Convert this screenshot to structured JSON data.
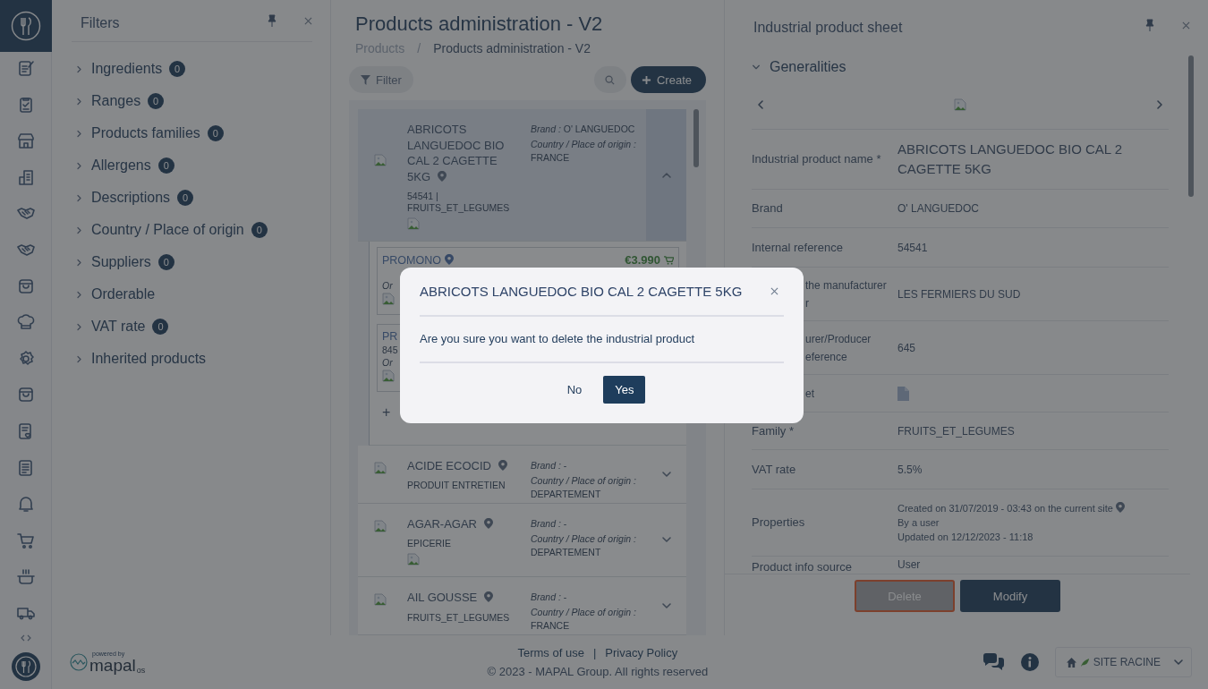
{
  "filters": {
    "title": "Filters",
    "items": [
      {
        "label": "Ingredients",
        "count": "0"
      },
      {
        "label": "Ranges",
        "count": "0"
      },
      {
        "label": "Products families",
        "count": "0"
      },
      {
        "label": "Allergens",
        "count": "0"
      },
      {
        "label": "Descriptions",
        "count": "0"
      },
      {
        "label": "Country / Place of origin",
        "count": "0"
      },
      {
        "label": "Suppliers",
        "count": "0"
      },
      {
        "label": "Orderable"
      },
      {
        "label": "VAT rate",
        "count": "0"
      },
      {
        "label": "Inherited products"
      }
    ]
  },
  "products": {
    "title": "Products administration - V2",
    "breadcrumb": [
      "Products",
      "Products administration - V2"
    ],
    "breadcrumb_separator": "/",
    "filter_button": "Filter",
    "create_button": "Create",
    "rows": [
      {
        "name": "ABRICOTS LANGUEDOC BIO CAL 2 CAGETTE 5KG",
        "meta": "54541 | FRUITS_ET_LEGUMES",
        "extra_image": true,
        "brand_label": "Brand :",
        "brand": "O' LANGUEDOC",
        "origin_label": "Country / Place of origin :",
        "origin": "FRANCE",
        "expanded": true,
        "offers": [
          {
            "name": "PROMONO",
            "pin": true,
            "price": "€3.990",
            "order": "Or"
          },
          {
            "name": "PR",
            "pin": false,
            "code": "845",
            "order": "Or"
          }
        ],
        "add": "+"
      },
      {
        "name": "ACIDE ECOCID",
        "meta": "PRODUIT ENTRETIEN",
        "extra_image": false,
        "brand_label": "Brand :",
        "brand": "-",
        "origin_label": "Country / Place of origin :",
        "origin": "DEPARTEMENT",
        "expanded": false
      },
      {
        "name": "AGAR-AGAR",
        "meta": "EPICERIE",
        "extra_image": true,
        "brand_label": "Brand :",
        "brand": "-",
        "origin_label": "Country / Place of origin :",
        "origin": "DEPARTEMENT",
        "expanded": false
      },
      {
        "name": "AIL GOUSSE",
        "meta": "FRUITS_ET_LEGUMES",
        "extra_image": false,
        "brand_label": "Brand :",
        "brand": "-",
        "origin_label": "Country / Place of origin :",
        "origin": "FRANCE",
        "expanded": false
      }
    ]
  },
  "sheet": {
    "title": "Industrial product sheet",
    "section": "Generalities",
    "expanded": true,
    "fields": [
      {
        "label": [
          "Industrial product name *"
        ],
        "value": [
          "ABRICOTS LANGUEDOC BIO CAL 2 CAGETTE 5KG"
        ],
        "kind": "text"
      },
      {
        "label": [
          "Brand"
        ],
        "value": [
          "O' LANGUEDOC"
        ],
        "kind": "text"
      },
      {
        "label": [
          "Internal reference"
        ],
        "value": [
          "54541"
        ],
        "kind": "text"
      },
      {
        "label": [
          "the manufacturer",
          "r"
        ],
        "partial": true,
        "value": [
          "LES FERMIERS DU SUD"
        ],
        "kind": "text"
      },
      {
        "label": [
          "urer/Producer",
          "eference"
        ],
        "partial": true,
        "value": [
          "645"
        ],
        "kind": "text"
      },
      {
        "label": [
          "et"
        ],
        "partial": true,
        "kind": "file"
      },
      {
        "label": [
          "Family *"
        ],
        "value": [
          "FRUITS_ET_LEGUMES"
        ],
        "kind": "text"
      },
      {
        "label": [
          "VAT rate"
        ],
        "value": [
          "5.5%"
        ],
        "kind": "text"
      },
      {
        "label": [
          "Properties"
        ],
        "value": [
          "Created on 31/07/2019 - 03:43 on the current site",
          "By a user",
          "Updated on 12/12/2023 - 11:18"
        ],
        "kind": "properties"
      },
      {
        "label": [
          "Product info source"
        ],
        "value": [
          "User"
        ],
        "kind": "text"
      }
    ],
    "buttons": [
      {
        "label": "Delete",
        "kind": "danger",
        "disabled": true
      },
      {
        "label": "Modify",
        "kind": "primary",
        "disabled": false
      }
    ]
  },
  "modal": {
    "title": "ABRICOTS LANGUEDOC BIO CAL 2 CAGETTE 5KG",
    "message": "Are you sure you want to delete the industrial product",
    "buttons": [
      {
        "label": "No",
        "kind": "plain"
      },
      {
        "label": "Yes",
        "kind": "primary"
      }
    ]
  },
  "footer": {
    "powered_by": "powered by",
    "brand": "mapal",
    "brand_suffix": "os",
    "links": [
      "Terms of use",
      "Privacy Policy"
    ],
    "separator": "|",
    "copyright": "© 2023 - MAPAL Group. All rights reserved",
    "site": "SITE RACINE"
  }
}
